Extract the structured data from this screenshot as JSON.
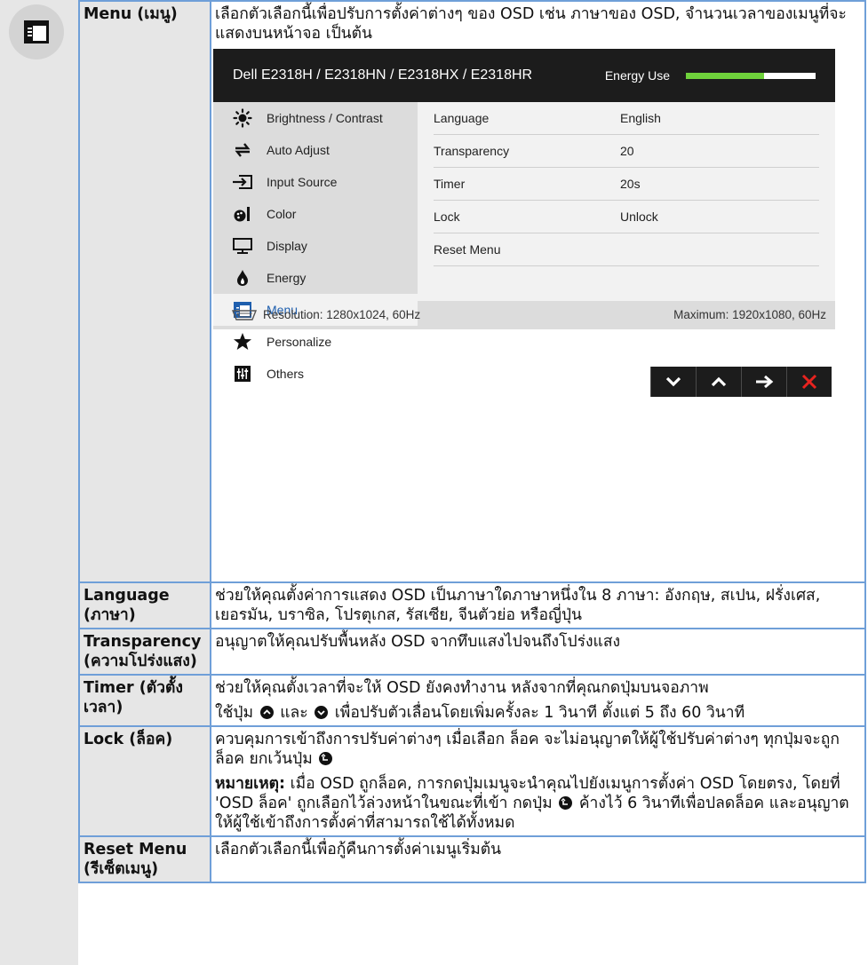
{
  "menu_row": {
    "label": "Menu (เมนู)",
    "description": "เลือกตัวเลือกนี้เพื่อปรับการตั้งค่าต่างๆ ของ OSD เช่น ภาษาของ OSD, จำนวนเวลาของเมนูที่จะแสดงบนหน้าจอ เป็นต้น"
  },
  "osd": {
    "title": "Dell E2318H / E2318HN / E2318HX / E2318HR",
    "energy_label": "Energy Use",
    "energy_level": 0.6,
    "menu_items": [
      {
        "label": "Brightness / Contrast",
        "icon": "brightness-icon"
      },
      {
        "label": "Auto Adjust",
        "icon": "auto-adjust-icon"
      },
      {
        "label": "Input Source",
        "icon": "input-source-icon"
      },
      {
        "label": "Color",
        "icon": "color-icon"
      },
      {
        "label": "Display",
        "icon": "display-icon"
      },
      {
        "label": "Energy",
        "icon": "energy-icon"
      },
      {
        "label": "Menu",
        "icon": "menu-icon",
        "active": true
      },
      {
        "label": "Personalize",
        "icon": "star-icon"
      },
      {
        "label": "Others",
        "icon": "others-icon"
      }
    ],
    "settings": [
      {
        "name": "Language",
        "value": "English"
      },
      {
        "name": "Transparency",
        "value": "20"
      },
      {
        "name": "Timer",
        "value": "20s"
      },
      {
        "name": "Lock",
        "value": "Unlock"
      },
      {
        "name": "Reset Menu",
        "value": ""
      }
    ],
    "resolution": "Resolution: 1280x1024, 60Hz",
    "maximum": "Maximum: 1920x1080, 60Hz",
    "nav_buttons": [
      "down-icon",
      "up-icon",
      "right-arrow-icon",
      "close-icon"
    ]
  },
  "rows": {
    "language": {
      "label": "Language (ภาษา)",
      "text": "ช่วยให้คุณตั้งค่าการแสดง OSD เป็นภาษาใดภาษาหนึ่งใน 8 ภาษา: อังกฤษ, สเปน, ฝรั่งเศส, เยอรมัน, บราซิล, โปรตุเกส, รัสเซีย, จีนตัวย่อ หรือญี่ปุ่น"
    },
    "transparency": {
      "label": "Transparency (ความโปร่งแสง)",
      "text": "อนุญาตให้คุณปรับพื้นหลัง OSD จากทึบแสงไปจนถึงโปร่งแสง"
    },
    "timer": {
      "label": "Timer (ตัวตั้งเวลา)",
      "text1": "ช่วยให้คุณตั้งเวลาที่จะให้ OSD ยังคงทำงาน หลังจากที่คุณกดปุ่มบนจอภาพ",
      "text2_a": "ใช้ปุ่ม",
      "text2_b": "และ",
      "text2_c": "เพื่อปรับตัวเลื่อนโดยเพิ่มครั้งละ 1 วินาที ตั้งแต่ 5 ถึง 60 วินาที"
    },
    "lock": {
      "label": "Lock (ล็อค)",
      "text1": "ควบคุมการเข้าถึงการปรับค่าต่างๆ เมื่อเลือก ล็อค จะไม่อนุญาตให้ผู้ใช้ปรับค่าต่างๆ ทุกปุ่มจะถูกล็อค ยกเว้นปุ่ม",
      "note_label": "หมายเหตุ:",
      "note_a": "เมื่อ OSD ถูกล็อค, การกดปุ่มเมนูจะนำคุณไปยังเมนูการตั้งค่า OSD โดยตรง, โดยที่ 'OSD ล็อค' ถูกเลือกไว้ล่วงหน้าในขณะที่เข้า กดปุ่ม",
      "note_b": "ค้างไว้ 6 วินาทีเพื่อปลดล็อค และอนุญาตให้ผู้ใช้เข้าถึงการตั้งค่าที่สามารถใช้ได้ทั้งหมด"
    },
    "reset": {
      "label": "Reset Menu (รีเซ็ตเมนู)",
      "text": "เลือกตัวเลือกนี้เพื่อกู้คืนการตั้งค่าเมนูเริ่มต้น"
    }
  }
}
